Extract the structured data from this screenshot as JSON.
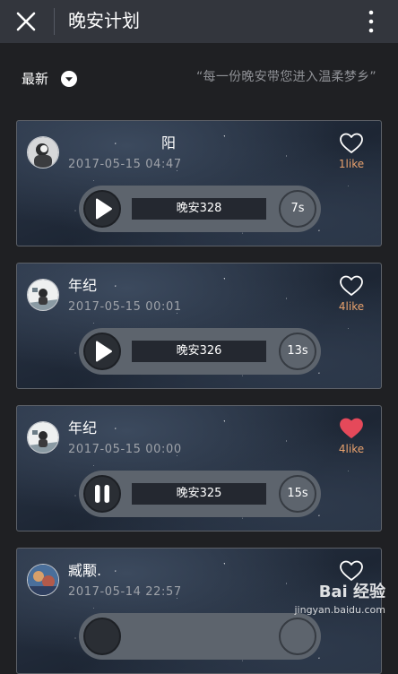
{
  "header": {
    "title": "晚安计划",
    "close_icon": "close-icon",
    "more_icon": "more-vertical-icon"
  },
  "filter": {
    "label": "最新",
    "icon": "chevron-down-icon"
  },
  "slogan": "“每一份晚安带您进入温柔梦乡”",
  "colors": {
    "like_count": "#e9a26d",
    "liked_heart": "#e5495a",
    "topbar": "#33363d"
  },
  "posts": [
    {
      "user": "阳",
      "time": "2017-05-15 04:47",
      "likes": "1like",
      "liked": false,
      "track": "晚安328",
      "duration": "7s",
      "state": "paused"
    },
    {
      "user": "年纪",
      "time": "2017-05-15 00:01",
      "likes": "4like",
      "liked": false,
      "track": "晚安326",
      "duration": "13s",
      "state": "paused"
    },
    {
      "user": "年纪",
      "time": "2017-05-15 00:00",
      "likes": "4like",
      "liked": true,
      "track": "晚安325",
      "duration": "15s",
      "state": "playing"
    },
    {
      "user": "臧颙.",
      "time": "2017-05-14 22:57",
      "likes": "",
      "liked": false,
      "track": "",
      "duration": "",
      "state": "paused"
    }
  ],
  "watermark": {
    "brand": "Bai 经验",
    "url": "jingyan.baidu.com"
  }
}
